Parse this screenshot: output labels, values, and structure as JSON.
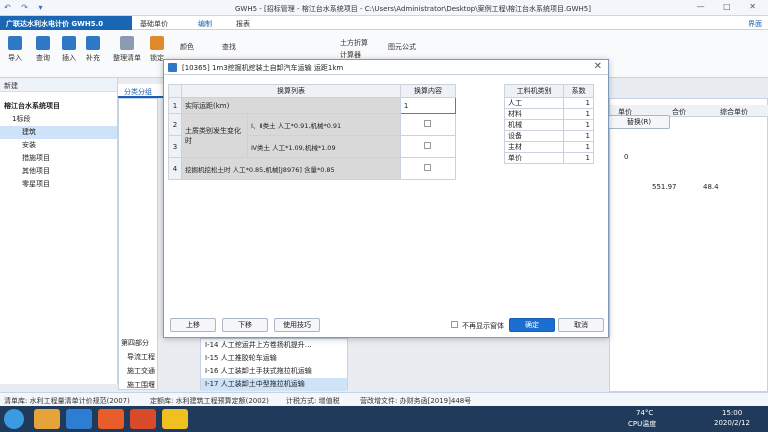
{
  "window": {
    "app_short": "GWH5",
    "title": "GWH5 - [招标管理 - 榕江台水系统项目 - C:\\Users\\Administrator\\Desktop\\案例工程\\榕江台水系统项目.GWH5]"
  },
  "menu": {
    "brand": "广联达水利水电计价 GWH5.0",
    "items": [
      "基础单价",
      "编制",
      "报表"
    ],
    "active": "编制",
    "right_label": "界面"
  },
  "ribbon": {
    "buttons": [
      "导入",
      "查询",
      "插入",
      "补充",
      "整理清单",
      "锁定"
    ],
    "tools": [
      "颜色",
      "查找",
      "土方折算",
      "计算器",
      "图元公式"
    ]
  },
  "sidebar": {
    "header": "新建",
    "tab": "分类分组",
    "tree": [
      {
        "label": "榕江台水系统项目",
        "level": 0
      },
      {
        "label": "1标段",
        "level": 1
      },
      {
        "label": "建筑",
        "level": 2,
        "selected": true
      },
      {
        "label": "安装",
        "level": 2
      },
      {
        "label": "措施项目",
        "level": 2
      },
      {
        "label": "其他项目",
        "level": 2
      },
      {
        "label": "零星项目",
        "level": 2
      }
    ]
  },
  "background": {
    "right_headers": [
      "单价",
      "合价",
      "综合单价"
    ],
    "values": [
      "551.97",
      "48.4",
      "0"
    ],
    "replace_button": "替换(R)",
    "list": [
      "I-14 人工挖运井上方卷扬机提升…",
      "I-15 人工推胶轮车运输",
      "I-16 人工装卸土手扶式拖拉机运输",
      "I-17 人工装卸土中型拖拉机运输"
    ],
    "left_list": [
      "第四部分",
      "导流工程",
      "施工交通",
      "施工围堰"
    ]
  },
  "dialog": {
    "title": "[10365] 1m3挖掘机挖装土自卸汽车运输 运距1km",
    "headers": [
      "换算列表",
      "换算内容"
    ],
    "rows": [
      {
        "num": "1",
        "label": "实际运距(km)",
        "value": "1"
      },
      {
        "num": "2",
        "group": "土质类别发生变化时",
        "label": "Ⅰ、Ⅱ类土 人工*0.91,机械*0.91",
        "value": ""
      },
      {
        "num": "3",
        "group": "",
        "label": "Ⅳ类土 人工*1.09,机械*1.09",
        "value": ""
      },
      {
        "num": "4",
        "label": "挖掘机挖松土时 人工*0.85,机械[J8976] 含量*0.85",
        "value": ""
      }
    ],
    "side_headers": [
      "工料机类别",
      "系数"
    ],
    "side_rows": [
      {
        "cat": "人工",
        "coef": "1"
      },
      {
        "cat": "材料",
        "coef": "1"
      },
      {
        "cat": "机械",
        "coef": "1"
      },
      {
        "cat": "设备",
        "coef": "1"
      },
      {
        "cat": "主材",
        "coef": "1"
      },
      {
        "cat": "单价",
        "coef": "1"
      }
    ],
    "btn_up": "上移",
    "btn_down": "下移",
    "btn_tips": "使用技巧",
    "no_show": "不再显示窗体",
    "ok": "确定",
    "cancel": "取消"
  },
  "status": {
    "list_spec": "清单库: 水利工程量清单计价规范(2007)",
    "quota": "定额库: 水利建筑工程预算定额(2002)",
    "tax": "计税方式: 增值税",
    "doc": "营改增文件: 办财务函[2019]448号"
  },
  "taskbar": {
    "temp": "74°C",
    "temp_label": "CPU温度",
    "time": "15:00",
    "date": "2020/2/12"
  },
  "colors": {
    "brand": "#1a66b3",
    "primary_button": "#1a6fd0"
  }
}
